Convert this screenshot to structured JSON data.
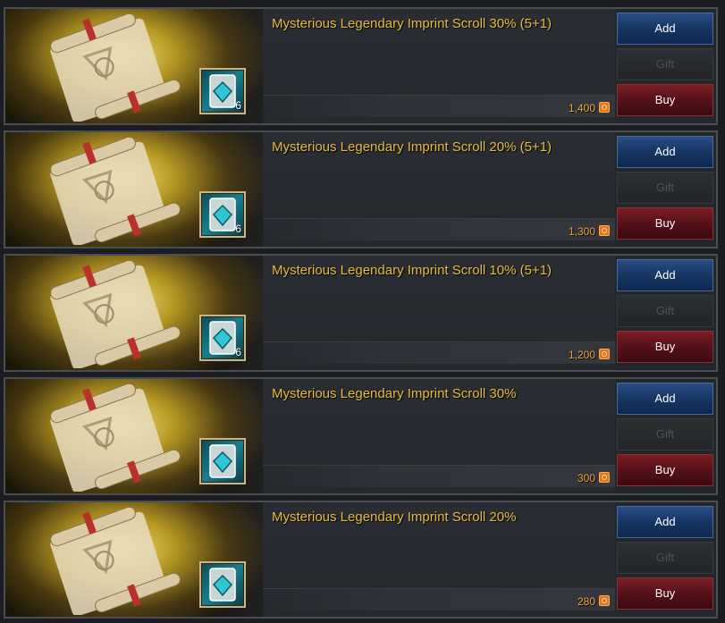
{
  "buttons": {
    "add": "Add",
    "gift": "Gift",
    "buy": "Buy"
  },
  "items": [
    {
      "title": "Mysterious Legendary Imprint Scroll 30% (5+1)",
      "price": "1,400",
      "count": "6"
    },
    {
      "title": "Mysterious Legendary Imprint Scroll 20% (5+1)",
      "price": "1,300",
      "count": "6"
    },
    {
      "title": "Mysterious Legendary Imprint Scroll 10% (5+1)",
      "price": "1,200",
      "count": "6"
    },
    {
      "title": "Mysterious Legendary Imprint Scroll 30%",
      "price": "300",
      "count": ""
    },
    {
      "title": "Mysterious Legendary Imprint Scroll 20%",
      "price": "280",
      "count": ""
    }
  ],
  "icons": {
    "product": "scroll-icon",
    "badge": "imprint-gem-icon",
    "currency": "coin-icon"
  },
  "colors": {
    "title": "#e9ba3c",
    "price": "#f2a13a",
    "add": "#173765",
    "buy": "#55111a"
  }
}
